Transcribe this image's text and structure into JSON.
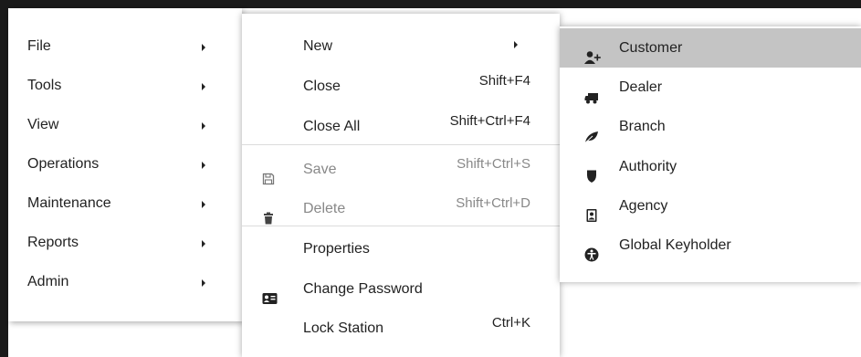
{
  "main_menu": {
    "items": [
      {
        "label": "File"
      },
      {
        "label": "Tools"
      },
      {
        "label": "View"
      },
      {
        "label": "Operations"
      },
      {
        "label": "Maintenance"
      },
      {
        "label": "Reports"
      },
      {
        "label": "Admin"
      }
    ]
  },
  "file_menu": {
    "items": [
      {
        "label": "New",
        "shortcut": "",
        "icon": "",
        "has_submenu": true,
        "disabled": false
      },
      {
        "label": "Close",
        "shortcut": "Shift+F4",
        "icon": "",
        "disabled": false
      },
      {
        "label": "Close All",
        "shortcut": "Shift+Ctrl+F4",
        "icon": "",
        "disabled": false
      },
      {
        "label": "Save",
        "shortcut": "Shift+Ctrl+S",
        "icon": "save-icon",
        "disabled": true
      },
      {
        "label": "Delete",
        "shortcut": "Shift+Ctrl+D",
        "icon": "trash-icon",
        "disabled": true
      },
      {
        "label": "Properties",
        "shortcut": "",
        "icon": "",
        "disabled": false
      },
      {
        "label": "Change Password",
        "shortcut": "",
        "icon": "id-card-icon",
        "disabled": false
      },
      {
        "label": "Lock Station",
        "shortcut": "Ctrl+K",
        "icon": "",
        "disabled": false
      }
    ]
  },
  "new_menu": {
    "items": [
      {
        "label": "Customer",
        "icon": "user-plus-icon",
        "highlighted": true
      },
      {
        "label": "Dealer",
        "icon": "truck-icon",
        "highlighted": false
      },
      {
        "label": "Branch",
        "icon": "leaf-icon",
        "highlighted": false
      },
      {
        "label": "Authority",
        "icon": "shield-icon",
        "highlighted": false
      },
      {
        "label": "Agency",
        "icon": "badge-icon",
        "highlighted": false
      },
      {
        "label": "Global Keyholder",
        "icon": "universal-access-icon",
        "highlighted": false
      }
    ]
  },
  "colors": {
    "highlight": "#c4c4c4",
    "disabled_text": "#888888",
    "window_frame": "#1a1a1a"
  }
}
